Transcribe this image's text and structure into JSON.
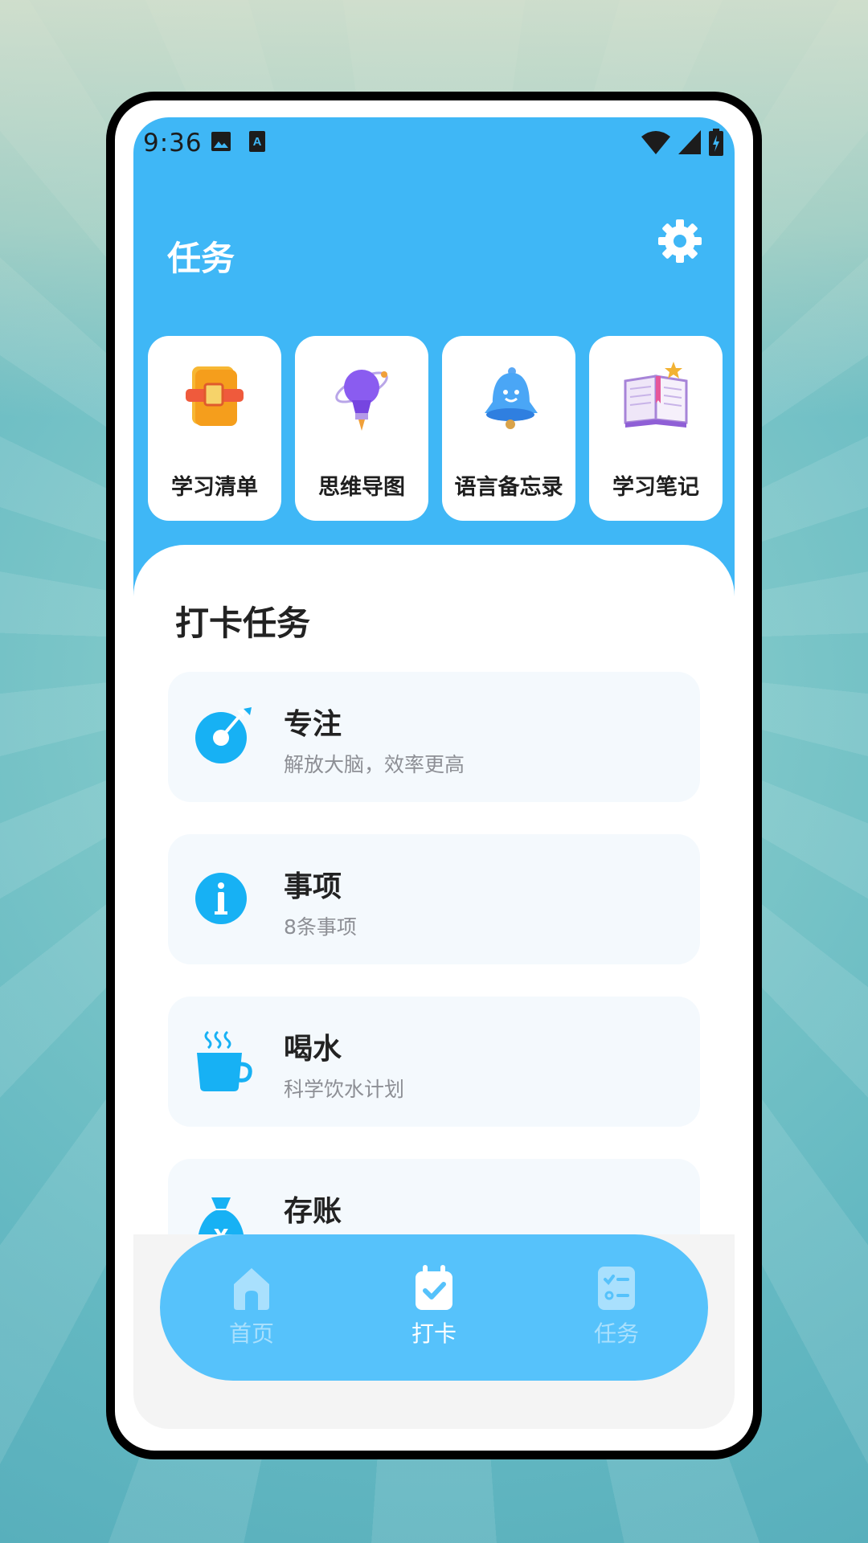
{
  "status": {
    "time": "9:36"
  },
  "header": {
    "title": "任务"
  },
  "quick_cards": [
    {
      "label": "学习清单",
      "icon": "book-icon"
    },
    {
      "label": "思维导图",
      "icon": "lightbulb-icon"
    },
    {
      "label": "语言备忘录",
      "icon": "bell-icon"
    },
    {
      "label": "学习笔记",
      "icon": "notebook-icon"
    }
  ],
  "section": {
    "title": "打卡任务"
  },
  "tasks": [
    {
      "name": "专注",
      "sub": "解放大脑，效率更高",
      "icon": "focus-target-icon"
    },
    {
      "name": "事项",
      "sub": "8条事项",
      "icon": "info-icon"
    },
    {
      "name": "喝水",
      "sub": "科学饮水计划",
      "icon": "cup-icon"
    },
    {
      "name": "存账",
      "sub": "",
      "icon": "money-bag-icon"
    }
  ],
  "nav": [
    {
      "label": "首页",
      "icon": "home-icon"
    },
    {
      "label": "打卡",
      "icon": "calendar-check-icon"
    },
    {
      "label": "任务",
      "icon": "checklist-icon"
    }
  ],
  "colors": {
    "accent": "#3fb7f6",
    "nav": "#56c2fb",
    "icon_blue": "#17b1f4"
  }
}
